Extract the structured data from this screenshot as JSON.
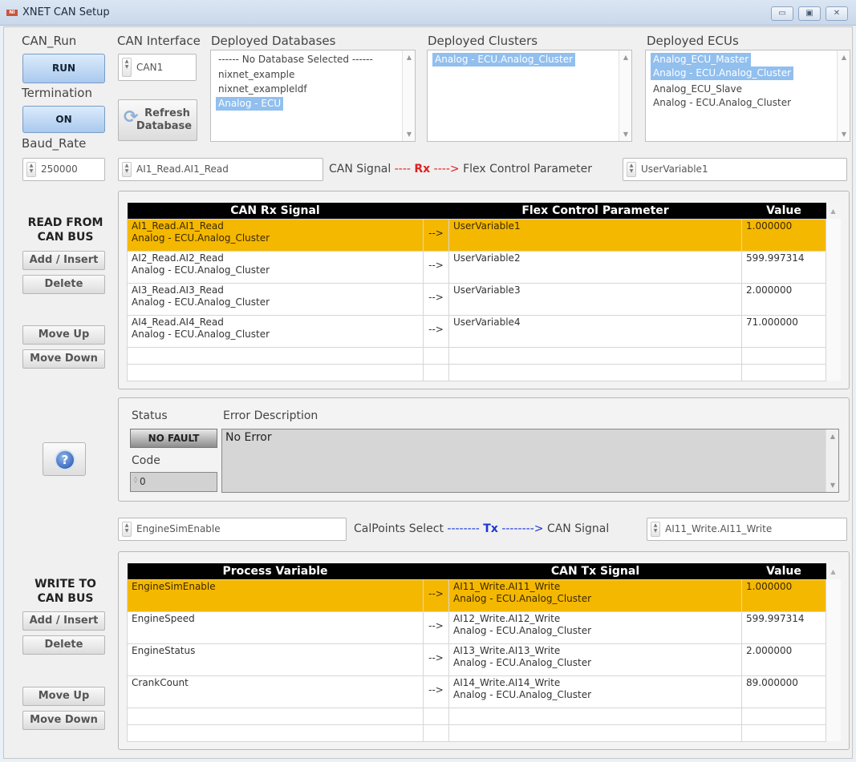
{
  "window": {
    "icon_text": "NI",
    "title": "XNET CAN Setup",
    "min_glyph": "▭",
    "max_glyph": "▣",
    "close_glyph": "✕"
  },
  "top": {
    "can_run_label": "CAN_Run",
    "run_button": "RUN",
    "termination_label": "Termination",
    "termination_button": "ON",
    "baud_label": "Baud_Rate",
    "baud_value": "250000",
    "can_interface_label": "CAN Interface",
    "can_interface_value": "CAN1",
    "refresh_button_line1": "Refresh",
    "refresh_button_line2": "Database",
    "deployed_databases_label": "Deployed Databases",
    "databases": [
      "------ No Database Selected ------",
      "nixnet_example",
      "nixnet_exampleldf",
      "Analog - ECU"
    ],
    "deployed_clusters_label": "Deployed Clusters",
    "clusters": [
      "Analog - ECU.Analog_Cluster"
    ],
    "deployed_ecus_label": "Deployed ECUs",
    "ecus": [
      "Analog_ECU_Master",
      "Analog - ECU.Analog_Cluster",
      "Analog_ECU_Slave",
      "Analog - ECU.Analog_Cluster"
    ]
  },
  "rx_mapping": {
    "signal_value": "AI1_Read.AI1_Read",
    "caption_left": "CAN Signal",
    "caption_dashes_left": "----",
    "caption_dir": "Rx",
    "caption_dashes_right": "---->",
    "caption_right": "Flex Control Parameter",
    "param_value": "UserVariable1"
  },
  "read": {
    "title_line1": "READ FROM",
    "title_line2": "CAN BUS",
    "add_button": "Add / Insert",
    "delete_button": "Delete",
    "move_up_button": "Move Up",
    "move_down_button": "Move Down",
    "headers": [
      "CAN Rx Signal",
      "",
      "Flex Control Parameter",
      "Value"
    ],
    "rows": [
      {
        "signal": "AI1_Read.AI1_Read",
        "cluster": "Analog - ECU.Analog_Cluster",
        "arrow": "-->",
        "param": "UserVariable1",
        "value": "1.000000"
      },
      {
        "signal": "AI2_Read.AI2_Read",
        "cluster": "Analog - ECU.Analog_Cluster",
        "arrow": "-->",
        "param": "UserVariable2",
        "value": "599.997314"
      },
      {
        "signal": "AI3_Read.AI3_Read",
        "cluster": "Analog - ECU.Analog_Cluster",
        "arrow": "-->",
        "param": "UserVariable3",
        "value": "2.000000"
      },
      {
        "signal": "AI4_Read.AI4_Read",
        "cluster": "Analog - ECU.Analog_Cluster",
        "arrow": "-->",
        "param": "UserVariable4",
        "value": "71.000000"
      }
    ]
  },
  "status": {
    "status_label": "Status",
    "status_value": "NO FAULT",
    "code_label": "Code",
    "code_value": "0",
    "error_label": "Error Description",
    "error_text": "No Error"
  },
  "tx_mapping": {
    "pv_value": "EngineSimEnable",
    "caption_left": "CalPoints Select",
    "caption_dashes_left": "--------",
    "caption_dir": "Tx",
    "caption_dashes_right": "-------->",
    "caption_right": "CAN Signal",
    "signal_value": "AI11_Write.AI11_Write"
  },
  "write": {
    "title_line1": "WRITE TO",
    "title_line2": "CAN BUS",
    "add_button": "Add / Insert",
    "delete_button": "Delete",
    "move_up_button": "Move Up",
    "move_down_button": "Move Down",
    "headers": [
      "Process Variable",
      "",
      "CAN Tx Signal",
      "Value"
    ],
    "rows": [
      {
        "pv": "EngineSimEnable",
        "arrow": "-->",
        "signal": "AI11_Write.AI11_Write",
        "cluster": "Analog - ECU.Analog_Cluster",
        "value": "1.000000"
      },
      {
        "pv": "EngineSpeed",
        "arrow": "-->",
        "signal": "AI12_Write.AI12_Write",
        "cluster": "Analog - ECU.Analog_Cluster",
        "value": "599.997314"
      },
      {
        "pv": "EngineStatus",
        "arrow": "-->",
        "signal": "AI13_Write.AI13_Write",
        "cluster": "Analog - ECU.Analog_Cluster",
        "value": "2.000000"
      },
      {
        "pv": "CrankCount",
        "arrow": "-->",
        "signal": "AI14_Write.AI14_Write",
        "cluster": "Analog - ECU.Analog_Cluster",
        "value": "89.000000"
      }
    ]
  },
  "help_glyph": "?",
  "colors": {
    "highlight": "#f5b800",
    "rx": "#e02020",
    "tx": "#1a37d6",
    "selection": "#91bfee"
  }
}
